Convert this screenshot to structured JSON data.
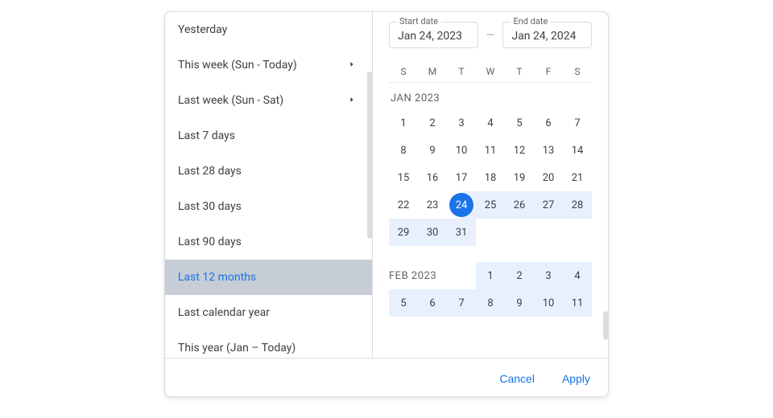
{
  "presets": [
    {
      "label": "Yesterday",
      "submenu": false,
      "active": false
    },
    {
      "label": "This week (Sun - Today)",
      "submenu": true,
      "active": false
    },
    {
      "label": "Last week (Sun - Sat)",
      "submenu": true,
      "active": false
    },
    {
      "label": "Last 7 days",
      "submenu": false,
      "active": false
    },
    {
      "label": "Last 28 days",
      "submenu": false,
      "active": false
    },
    {
      "label": "Last 30 days",
      "submenu": false,
      "active": false
    },
    {
      "label": "Last 90 days",
      "submenu": false,
      "active": false
    },
    {
      "label": "Last 12 months",
      "submenu": false,
      "active": true
    },
    {
      "label": "Last calendar year",
      "submenu": false,
      "active": false
    },
    {
      "label": "This year (Jan – Today)",
      "submenu": false,
      "active": false
    }
  ],
  "startField": {
    "label": "Start date",
    "value": "Jan 24, 2023"
  },
  "endField": {
    "label": "End date",
    "value": "Jan 24, 2024"
  },
  "dash": "—",
  "dow": [
    "S",
    "M",
    "T",
    "W",
    "T",
    "F",
    "S"
  ],
  "months": [
    {
      "label": "JAN 2023",
      "leading": 0,
      "days": 31,
      "start": 24,
      "rangeFrom": 25,
      "rangeTo": 31
    },
    {
      "label": "FEB 2023",
      "headerDays": [
        1,
        2,
        3,
        4
      ],
      "secondRow": [
        5,
        6,
        7,
        8,
        9,
        10,
        11
      ]
    }
  ],
  "footer": {
    "cancel": "Cancel",
    "apply": "Apply"
  }
}
